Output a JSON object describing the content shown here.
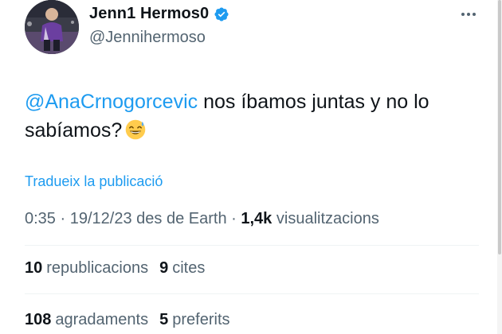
{
  "author": {
    "display_name": "Jenn1 Hermos0",
    "handle": "@Jennihermoso",
    "verified": true,
    "avatar": "player-photo"
  },
  "tweet": {
    "mention": "@AnaCrnogorcevic",
    "text": " nos íbamos juntas y no lo sabíamos?",
    "emoji": "grinning-face-with-sweat-icon"
  },
  "translate_label": "Tradueix la publicació",
  "meta": {
    "time": "0:35",
    "separator": "·",
    "date": "19/12/23",
    "source": "des de Earth",
    "views_count": "1,4k",
    "views_label": "visualitzacions"
  },
  "stats": {
    "reposts_count": "10",
    "reposts_label": "republicacions",
    "quotes_count": "9",
    "quotes_label": "cites",
    "likes_count": "108",
    "likes_label": "agradaments",
    "bookmarks_count": "5",
    "bookmarks_label": "preferits"
  },
  "colors": {
    "link": "#1d9bf0",
    "secondary_text": "#536471",
    "primary_text": "#0f1419",
    "verified_badge": "#1d9bf0"
  }
}
